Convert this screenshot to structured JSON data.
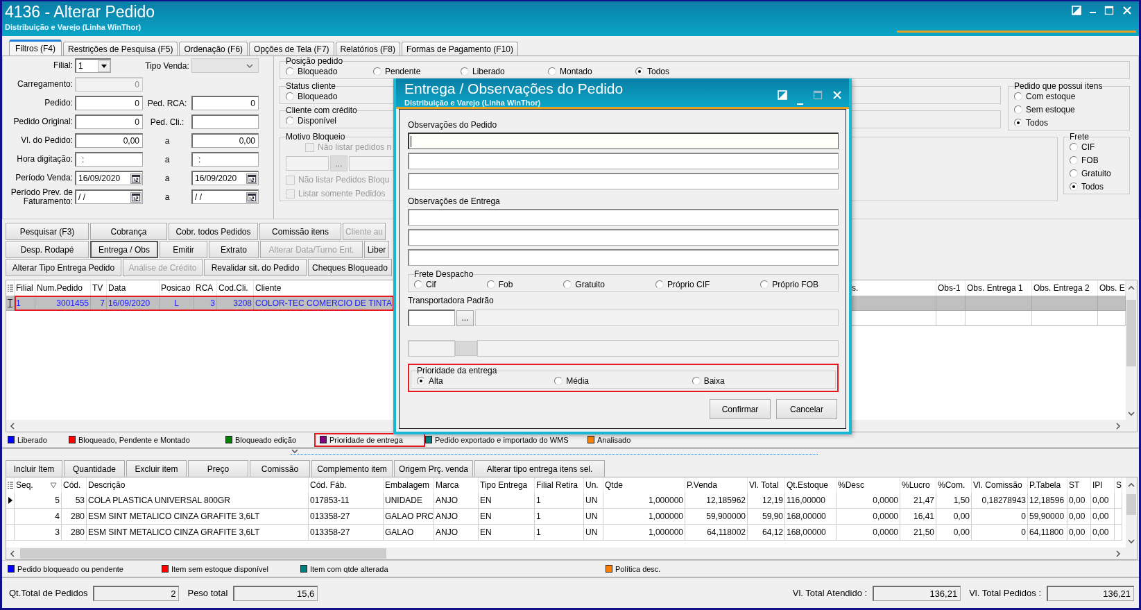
{
  "window": {
    "title": "4136 - Alterar Pedido",
    "subtitle": "Distribuição e Varejo (Linha WinThor)"
  },
  "tabs": [
    {
      "label": "Filtros (F4)",
      "selected": true
    },
    {
      "label": "Restrições de Pesquisa (F5)",
      "selected": false
    },
    {
      "label": "Ordenação (F6)",
      "selected": false
    },
    {
      "label": "Opções de Tela (F7)",
      "selected": false
    },
    {
      "label": "Relatórios (F8)",
      "selected": false
    },
    {
      "label": "Formas de Pagamento (F10)",
      "selected": false
    }
  ],
  "filters": [
    {
      "label": "Filial:",
      "field": {
        "kind": "combo",
        "value": "1",
        "disabled": false
      },
      "label2": "Tipo Venda:",
      "field2": {
        "kind": "combo",
        "disabled": true
      }
    },
    {
      "label": "Carregamento:",
      "field": {
        "kind": "number",
        "value": "0",
        "disabled": true
      }
    },
    {
      "label": "Pedido:",
      "field": {
        "kind": "number",
        "value": "0",
        "disabled": false
      },
      "label2": "Ped. RCA:",
      "field2": {
        "kind": "number",
        "value": "0",
        "disabled": false
      }
    },
    {
      "label": "Pedido Original:",
      "field": {
        "kind": "number",
        "value": "0",
        "disabled": false
      },
      "label2": "Ped. Cli.:",
      "field2": {
        "kind": "text",
        "disabled": false
      }
    },
    {
      "label": "Vl. do Pedido:",
      "field": {
        "kind": "number",
        "value": "0,00",
        "disabled": false
      },
      "label2": "a",
      "field2": {
        "kind": "number",
        "value": "0,00",
        "disabled": false
      }
    },
    {
      "label": "Hora digitação:",
      "field": {
        "kind": "text",
        "value": ":",
        "disabled": false
      },
      "label2": "a",
      "field2": {
        "kind": "text",
        "value": ":",
        "disabled": false
      }
    },
    {
      "label": "Período Venda:",
      "field": {
        "kind": "date",
        "value": "16/09/2020",
        "disabled": false
      },
      "label2": "a",
      "field2": {
        "kind": "date",
        "value": "16/09/2020",
        "disabled": false
      }
    },
    {
      "label": "Período Prev. de Faturamento:",
      "field": {
        "kind": "date",
        "value": "/ /",
        "disabled": false
      },
      "label2": "a",
      "field2": {
        "kind": "date",
        "value": "/ /",
        "disabled": false
      }
    }
  ],
  "posicao_pedido": {
    "title": "Posição pedido",
    "options": [
      {
        "label": "Bloqueado",
        "selected": false
      },
      {
        "label": "Pendente",
        "selected": false
      },
      {
        "label": "Liberado",
        "selected": false
      },
      {
        "label": "Montado",
        "selected": false
      },
      {
        "label": "Todos",
        "selected": true
      }
    ]
  },
  "status_cliente": {
    "title": "Status cliente",
    "options": [
      {
        "label": "Bloqueado",
        "selected": false
      }
    ]
  },
  "cliente_com_credito": {
    "title": "Cliente com crédito",
    "options": [
      {
        "label": "Disponível",
        "selected": false
      }
    ]
  },
  "pedido_que_possui_itens": {
    "title": "Pedido que possui itens",
    "options": [
      {
        "label": "Com estoque",
        "selected": false
      },
      {
        "label": "Sem estoque",
        "selected": false
      },
      {
        "label": "Todos",
        "selected": true
      }
    ]
  },
  "motivo_bloqueio": {
    "title": "Motivo Bloqueio",
    "lookup_button": "...",
    "checkboxes": [
      {
        "label": "Não listar pedidos n",
        "checked": false,
        "disabled": true
      },
      {
        "label": "Não listar Pedidos Bloqu",
        "checked": false,
        "disabled": true
      },
      {
        "label": "Listar somente Pedidos",
        "checked": false,
        "disabled": true
      }
    ]
  },
  "frete": {
    "title": "Frete",
    "options": [
      {
        "label": "CIF",
        "selected": false
      },
      {
        "label": "FOB",
        "selected": false
      },
      {
        "label": "Gratuito",
        "selected": false
      },
      {
        "label": "Todos",
        "selected": true
      }
    ]
  },
  "action_buttons": [
    [
      {
        "label": "Pesquisar (F3)",
        "disabled": false,
        "pressed": false
      },
      {
        "label": "Cobrança",
        "disabled": false,
        "pressed": false
      },
      {
        "label": "Cobr. todos Pedidos",
        "disabled": false,
        "pressed": false
      },
      {
        "label": "Comissão itens",
        "disabled": false,
        "pressed": false
      },
      {
        "label": "Cliente au",
        "disabled": true,
        "pressed": false
      }
    ],
    [
      {
        "label": "Desp. Rodapé",
        "disabled": false,
        "pressed": false
      },
      {
        "label": "Entrega / Obs",
        "disabled": false,
        "pressed": true
      },
      {
        "label": "Emitir",
        "disabled": false,
        "pressed": false
      },
      {
        "label": "Extrato",
        "disabled": false,
        "pressed": false
      },
      {
        "label": "Alterar Data/Turno Ent.",
        "disabled": true,
        "pressed": false
      },
      {
        "label": "Liber",
        "disabled": false,
        "pressed": false
      }
    ],
    [
      {
        "label": "Alterar Tipo Entrega Pedido",
        "disabled": false,
        "pressed": false
      },
      {
        "label": "Análise de Crédito",
        "disabled": true,
        "pressed": false
      },
      {
        "label": "Revalidar sit. do Pedido",
        "disabled": false,
        "pressed": false
      },
      {
        "label": "Cheques Bloqueado",
        "disabled": false,
        "pressed": false
      }
    ]
  ],
  "orders": {
    "columns": [
      "Filial",
      "Num.Pedido",
      "TV",
      "Data",
      "Posicao",
      "RCA",
      "Cod.Cli.",
      "Cliente"
    ],
    "columns_right": [
      "s.",
      "Obs-1",
      "Obs. Entrega 1",
      "Obs. Entrega 2",
      "Obs. E"
    ],
    "rows": [
      {
        "selected": true,
        "highlighted": true,
        "cells": [
          "1",
          "3001455",
          "7",
          "16/09/2020",
          "L",
          "3",
          "3208",
          "COLOR-TEC COMERCIO DE TINTA"
        ]
      }
    ]
  },
  "legend": [
    {
      "label": "Liberado",
      "color": "#0000ff",
      "highlighted": false
    },
    {
      "label": "Bloqueado, Pendente e Montado",
      "color": "#ff0000",
      "highlighted": false
    },
    {
      "label": "Bloqueado edição",
      "color": "#008000",
      "highlighted": false
    },
    {
      "label": "Prioridade de entrega",
      "color": "#800080",
      "highlighted": true
    },
    {
      "label": "Pedido exportado e importado do WMS",
      "color": "#008080",
      "highlighted": false
    },
    {
      "label": "Analisado",
      "color": "#ff8000",
      "highlighted": false
    }
  ],
  "item_buttons": [
    "Incluir Item",
    "Quantidade",
    "Excluir item",
    "Preço",
    "Comissão",
    "Complemento item",
    "Origem Prç. venda",
    "Alterar tipo entrega itens sel."
  ],
  "items": {
    "columns": [
      "Seq.",
      "Cód.",
      "Descrição",
      "Cód. Fáb.",
      "Embalagem",
      "Marca",
      "Tipo Entrega",
      "Filial Retira",
      "Un.",
      "Qtde",
      "P.Venda",
      "Vl. Total",
      "Qt.Estoque",
      "%Desc",
      "%Lucro",
      "%Com.",
      "Vl. Comissão",
      "P.Tabela",
      "ST",
      "IPI",
      "S"
    ],
    "rows": [
      {
        "current": true,
        "cells": [
          "5",
          "53",
          "COLA PLASTICA UNIVERSAL 800GR",
          "017853-11",
          "UNIDADE",
          "ANJO",
          "EN",
          "1",
          "UN",
          "1,000000",
          "12,185962",
          "12,19",
          "116,00000",
          "0,0000",
          "21,47",
          "1,50",
          "0,18278943",
          "12,18596",
          "0,00",
          "0,00"
        ]
      },
      {
        "current": false,
        "cells": [
          "4",
          "280",
          "ESM SINT METALICO CINZA GRAFITE 3,6LT",
          "013358-27",
          "GALAO PRC",
          "ANJO",
          "EN",
          "1",
          "UN",
          "1,000000",
          "59,900000",
          "59,90",
          "168,00000",
          "0,0000",
          "16,41",
          "0,00",
          "0",
          "59,90000",
          "0,00",
          "0,00"
        ]
      },
      {
        "current": false,
        "cells": [
          "3",
          "280",
          "ESM SINT METALICO CINZA GRAFITE 3,6LT",
          "013358-27",
          "GALAO",
          "ANJO",
          "EN",
          "1",
          "UN",
          "1,000000",
          "64,118002",
          "64,12",
          "168,00000",
          "0,0000",
          "21,50",
          "0,00",
          "0",
          "64,11800",
          "0,00",
          "0,00"
        ]
      }
    ]
  },
  "item_legend": [
    {
      "label": "Pedido bloqueado ou pendente",
      "color": "#0000ff"
    },
    {
      "label": "Item sem estoque disponível",
      "color": "#ff0000"
    },
    {
      "label": "Item com qtde alterada",
      "color": "#008080"
    },
    {
      "label": "Política desc.",
      "color": "#ff8000"
    }
  ],
  "totals_left": [
    {
      "label": "Qt.Total de Pedidos",
      "value": "2"
    },
    {
      "label": "Peso total",
      "value": "15,6"
    }
  ],
  "totals_right": [
    {
      "label": "Vl. Total Atendido :",
      "value": "136,21"
    },
    {
      "label": "Vl. Total Pedidos :",
      "value": "136,21"
    }
  ],
  "dialog": {
    "title": "Entrega / Observações do Pedido",
    "subtitle": "Distribuição e Varejo (Linha WinThor)",
    "observacoes_pedido": {
      "label": "Observações do Pedido",
      "fields": [
        {
          "focused": true
        },
        {
          "focused": false
        },
        {
          "focused": false
        }
      ]
    },
    "observacoes_entrega": {
      "label": "Observações de Entrega",
      "fields": [
        {
          "focused": false
        },
        {
          "focused": false
        },
        {
          "focused": false
        }
      ]
    },
    "frete_despacho": {
      "title": "Frete Despacho",
      "options": [
        {
          "label": "Cif",
          "selected": false
        },
        {
          "label": "Fob",
          "selected": false
        },
        {
          "label": "Gratuito",
          "selected": false
        },
        {
          "label": "Próprio CIF",
          "selected": false
        },
        {
          "label": "Próprio FOB",
          "selected": false
        }
      ]
    },
    "transportadora": {
      "label": "Transportadora Padrão",
      "lookup_button": "..."
    },
    "prioridade": {
      "title": "Prioridade da entrega",
      "highlighted": true,
      "options": [
        {
          "label": "Alta",
          "selected": true
        },
        {
          "label": "Média",
          "selected": false
        },
        {
          "label": "Baixa",
          "selected": false
        }
      ]
    },
    "buttons": [
      "Confirmar",
      "Cancelar"
    ]
  }
}
